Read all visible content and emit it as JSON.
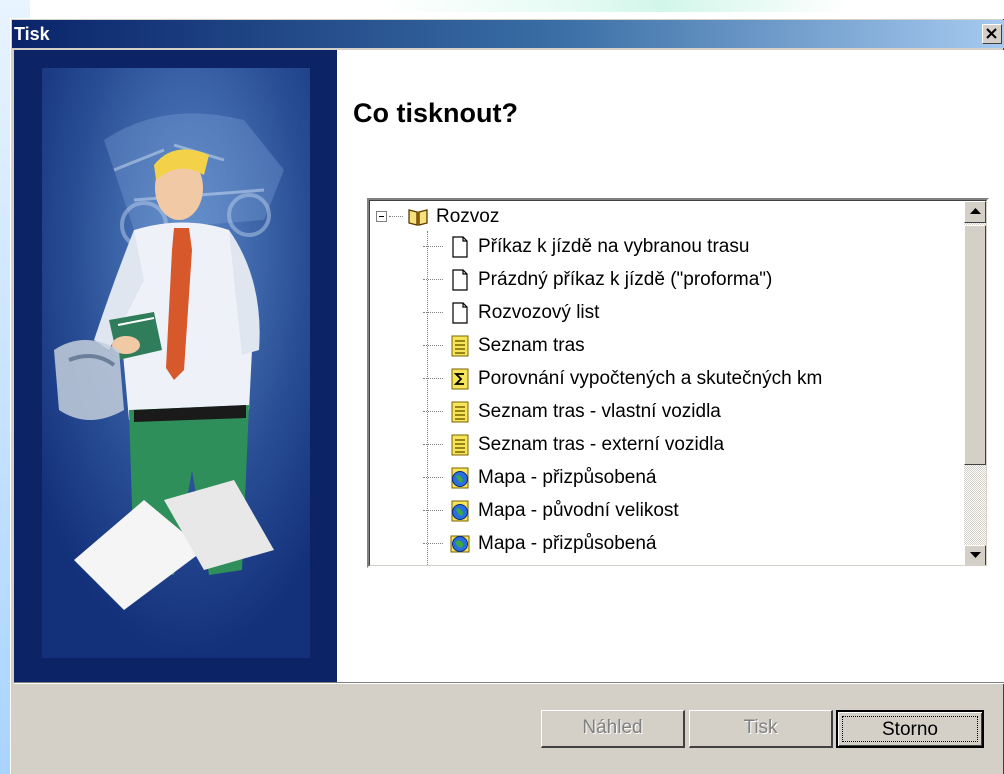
{
  "window": {
    "title": "Tisk",
    "close_icon": "close-icon"
  },
  "main": {
    "heading": "Co tisknout?"
  },
  "tree": {
    "root": {
      "label": "Rozvoz",
      "icon": "book-icon",
      "expanded": true
    },
    "items": [
      {
        "label": "Příkaz k jízdě na vybranou trasu",
        "icon": "document-icon"
      },
      {
        "label": "Prázdný příkaz k jízdě (\"proforma\")",
        "icon": "document-icon"
      },
      {
        "label": "Rozvozový list",
        "icon": "document-icon"
      },
      {
        "label": "Seznam tras",
        "icon": "list-report-icon"
      },
      {
        "label": "Porovnání vypočtených a skutečných km",
        "icon": "sum-report-icon"
      },
      {
        "label": "Seznam tras - vlastní vozidla",
        "icon": "list-report-icon"
      },
      {
        "label": "Seznam tras - externí vozidla",
        "icon": "list-report-icon"
      },
      {
        "label": "Mapa - přizpůsobená",
        "icon": "globe-icon"
      },
      {
        "label": "Mapa - původní velikost",
        "icon": "globe-icon"
      },
      {
        "label": "Mapa - přizpůsobená",
        "icon": "globe-icon"
      }
    ]
  },
  "buttons": {
    "preview": "Náhled",
    "print": "Tisk",
    "cancel": "Storno"
  },
  "colors": {
    "titlebar_start": "#0a246a",
    "titlebar_end": "#a6caf0",
    "dialog_face": "#d4d0c8",
    "side_panel": "#0c2466"
  }
}
